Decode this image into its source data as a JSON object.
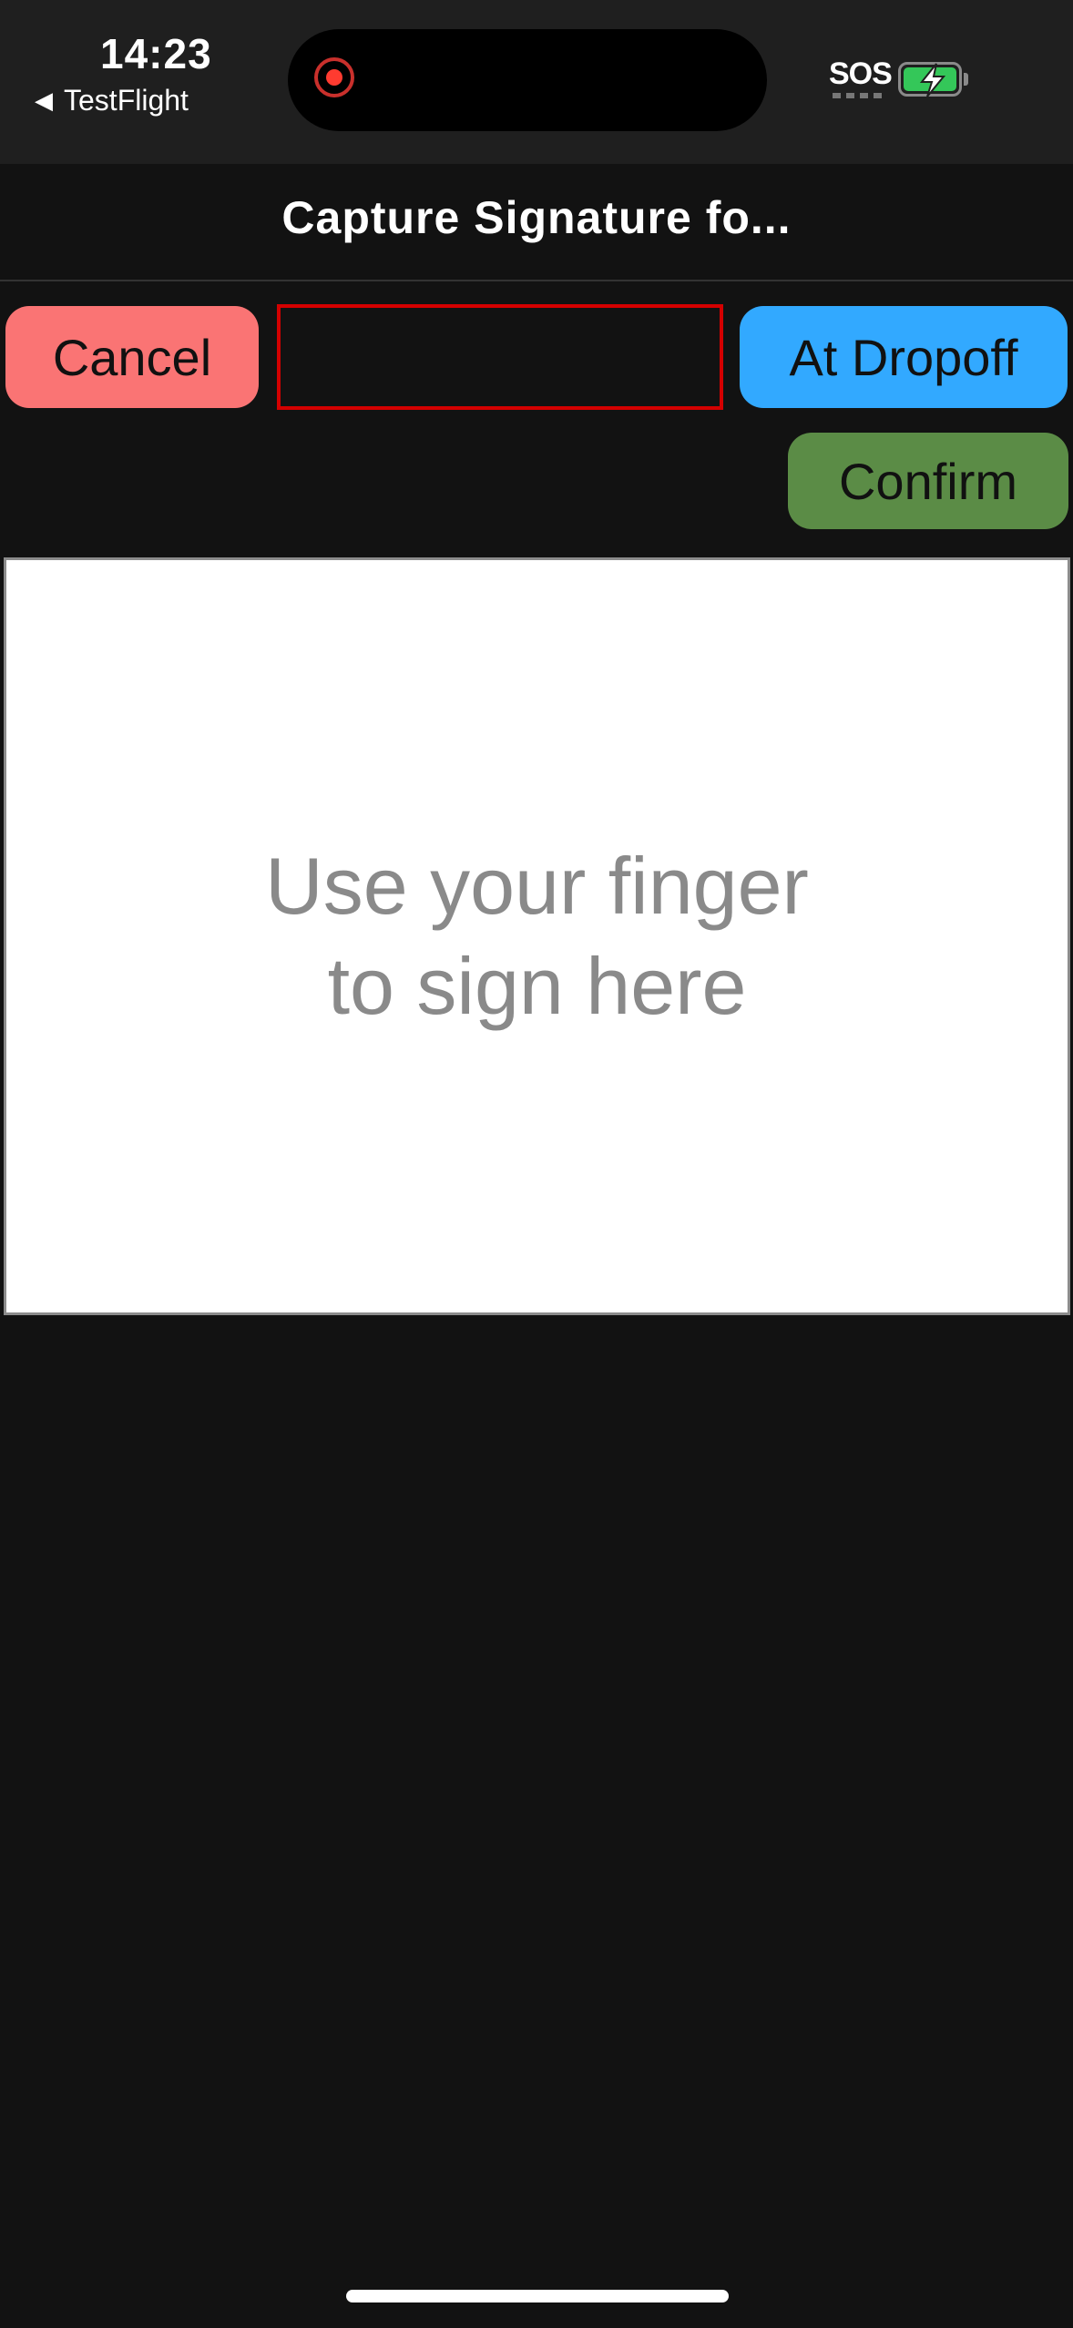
{
  "status_bar": {
    "time": "14:23",
    "back_app": "TestFlight",
    "sos": "SOS",
    "record_color": "#ff3b30",
    "battery_color": "#34c759"
  },
  "nav": {
    "title": "Capture Signature fo..."
  },
  "toolbar": {
    "cancel_label": "Cancel",
    "name_value": "",
    "dropoff_label": "At Dropoff",
    "confirm_label": "Confirm",
    "cancel_color": "#fa7474",
    "dropoff_color": "#32a9ff",
    "confirm_color": "#5b8c46",
    "field_border_color": "#d40000"
  },
  "signature": {
    "hint": "Use your finger to sign here"
  }
}
